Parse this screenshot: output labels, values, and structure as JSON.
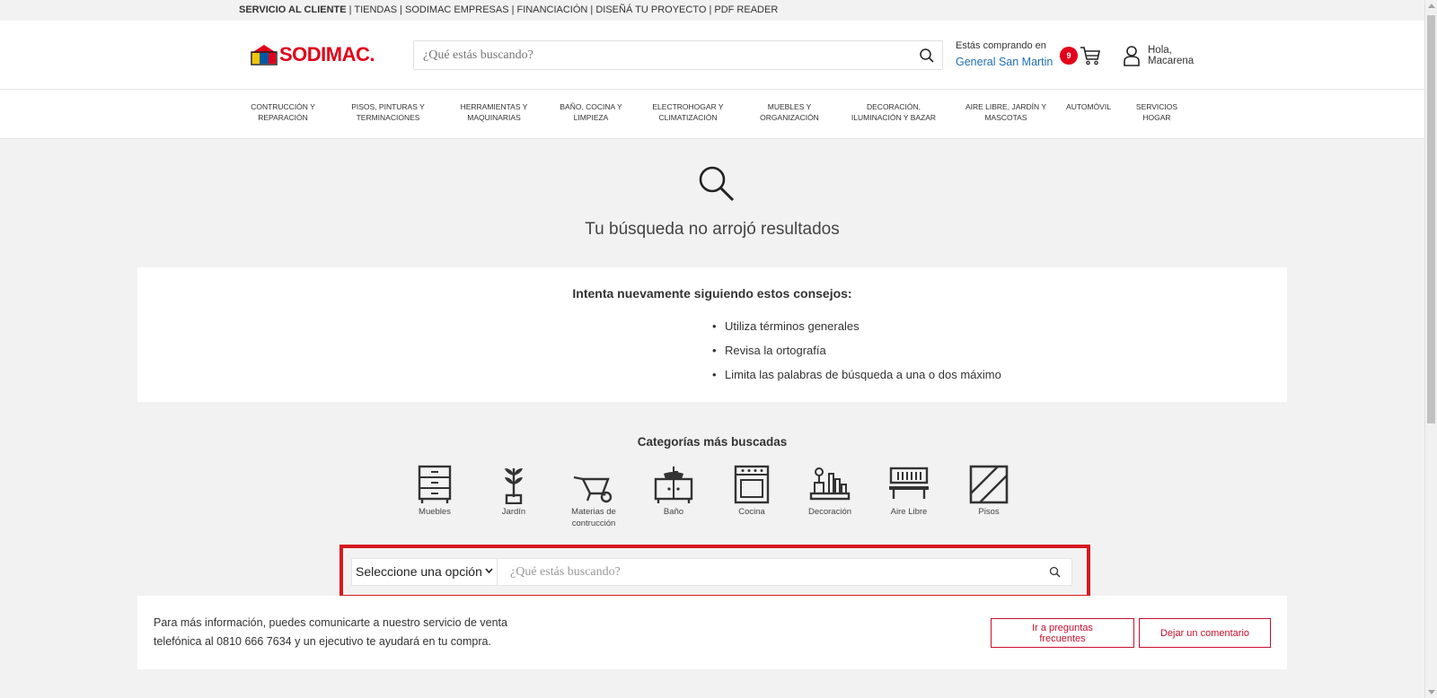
{
  "topbar": {
    "links": [
      "SERVICIO AL CLIENTE",
      " | TIENDAS | ",
      "SODIMAC EMPRESAS | ",
      " FINANCIACIÓN | ",
      " DISEÑÁ TU PROYECTO ",
      " | PDF READER"
    ]
  },
  "header": {
    "logo_text": "SODIMAC.",
    "search_placeholder": "¿Qué estás buscando?",
    "store_label": "Estás comprando en",
    "store_city": "General San Martin",
    "cart_count": "9",
    "greeting_line1": "Hola,",
    "greeting_line2": "Macarena"
  },
  "nav": {
    "items": [
      {
        "line1": "CONTRUCCIÓN Y",
        "line2": "REPARACIÓN"
      },
      {
        "line1": "PISOS, PINTURAS Y",
        "line2": "TERMINACIONES"
      },
      {
        "line1": "HERRAMIENTAS Y",
        "line2": "MAQUINARIAS"
      },
      {
        "line1": "BAÑO, COCINA Y",
        "line2": "LIMPIEZA"
      },
      {
        "line1": "ELECTROHOGAR Y",
        "line2": "CLIMATIZACIÓN"
      },
      {
        "line1": "MUEBLES Y",
        "line2": "ORGANIZACIÓN"
      },
      {
        "line1": "DECORACIÓN,",
        "line2": "ILUMINACIÓN Y BAZAR"
      },
      {
        "line1": "AIRE LIBRE, JARDÍN Y",
        "line2": "MASCOTAS"
      },
      {
        "line1": "AUTOMÓVIL",
        "line2": ""
      },
      {
        "line1": "SERVICIOS",
        "line2": "HOGAR"
      }
    ]
  },
  "main": {
    "no_results": "Tu búsqueda no arrojó resultados",
    "tips_title": "Intenta nuevamente siguiendo estos consejos:",
    "tips": [
      "Utiliza términos generales",
      "Revisa la ortografía",
      "Limita las palabras de búsqueda a una o dos máximo"
    ],
    "categories_title": "Categorías más buscadas",
    "categories": [
      {
        "label": "Muebles",
        "icon": "dresser-icon"
      },
      {
        "label": "Jardín",
        "icon": "plant-icon"
      },
      {
        "label": "Materias de contrucción",
        "icon": "wheelbarrow-icon"
      },
      {
        "label": "Baño",
        "icon": "bathroom-vanity-icon"
      },
      {
        "label": "Cocina",
        "icon": "oven-icon"
      },
      {
        "label": "Decoración",
        "icon": "shelf-decor-icon"
      },
      {
        "label": "Aire Libre",
        "icon": "bench-icon"
      },
      {
        "label": "Pisos",
        "icon": "floor-tile-icon"
      }
    ],
    "select_value": "Seleccione una opción",
    "search2_placeholder": "¿Qué estás buscando?"
  },
  "info": {
    "line1": "Para más información, puedes comunicarte a nuestro servicio de venta",
    "line2": "telefónica al 0810 666 7634 y un ejecutivo te ayudará en tu compra.",
    "faq_line1": "Ir a preguntas",
    "faq_line2": "frecuentes",
    "comment_button": "Dejar un comentario"
  },
  "colors": {
    "brand_red": "#e2001a",
    "highlight_red": "#d71920",
    "link_blue": "#1f6fb5"
  }
}
